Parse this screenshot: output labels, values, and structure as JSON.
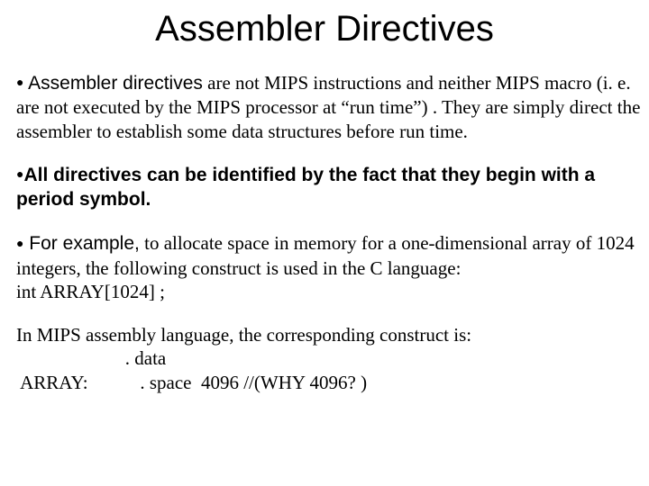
{
  "title": "Assembler Directives",
  "p1": {
    "lead": " Assembler directives",
    "rest": " are not MIPS instructions and neither MIPS macro (i. e. are not executed  by the MIPS processor at “run time”) . They are simply direct the assembler to establish some data structures before run  time."
  },
  "p2": "All directives can be identified by the fact that they begin with  a period symbol.",
  "p3": {
    "lead": " For example,",
    "rest": " to allocate space in memory for a one-dimensional array of 1024 integers, the following construct is used in the C language:",
    "code": " int ARRAY[1024] ;"
  },
  "p4": {
    "intro": "  In MIPS assembly language, the corresponding construct is:",
    "line1": "                       . data",
    "line2": " ARRAY:           . space  4096 //(WHY 4096? )"
  },
  "bullet": "●"
}
